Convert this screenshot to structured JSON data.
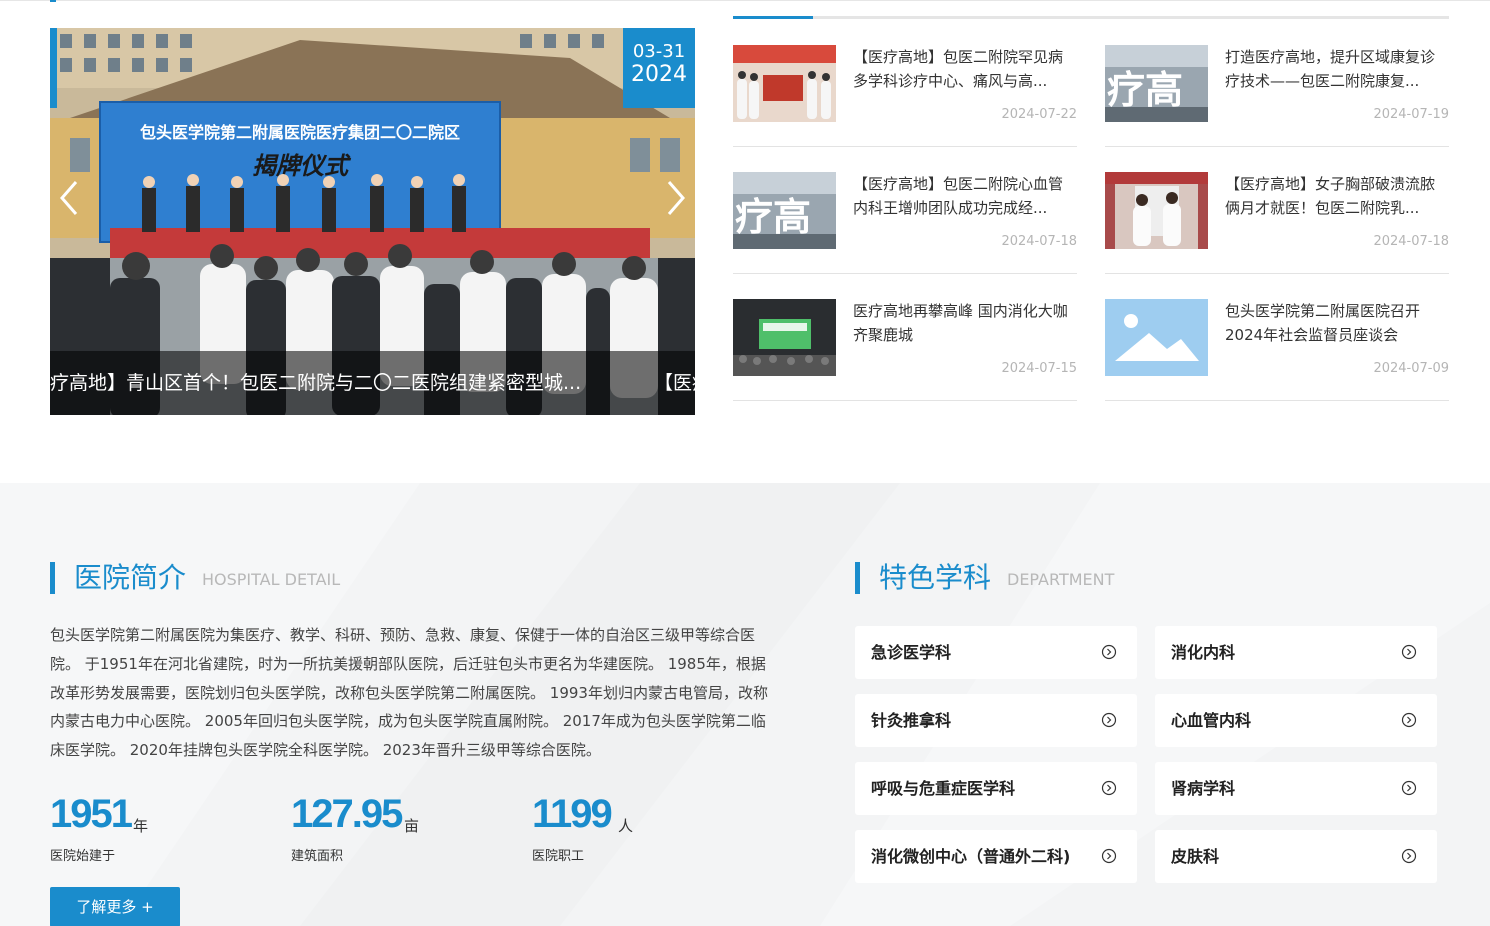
{
  "slider": {
    "date_md": "03-31",
    "date_year": "2024",
    "caption_current": "疗高地】青山区首个！包医二附院与二〇二医院组建紧密型城...",
    "caption_next": "【医疗",
    "banner_title": "包头医学院第二附属医院医疗集团二〇二院区",
    "banner_subtitle": "揭牌仪式",
    "prev_icon": "chevron-left-icon",
    "next_icon": "chevron-right-icon"
  },
  "news": [
    {
      "title": "【医疗高地】包医二附院罕见病多学科诊疗中心、痛风与高...",
      "date": "2024-07-22",
      "thumb": "photo"
    },
    {
      "title": "打造医疗高地，提升区域康复诊疗技术——包医二附院康复...",
      "date": "2024-07-19",
      "thumb": "photo"
    },
    {
      "title": "【医疗高地】包医二附院心血管内科王增帅团队成功完成经...",
      "date": "2024-07-18",
      "thumb": "photo"
    },
    {
      "title": "【医疗高地】女子胸部破溃流脓俩月才就医！包医二附院乳...",
      "date": "2024-07-18",
      "thumb": "photo"
    },
    {
      "title": "医疗高地再攀高峰 国内消化大咖齐聚鹿城",
      "date": "2024-07-15",
      "thumb": "photo"
    },
    {
      "title": "包头医学院第二附属医院召开2024年社会监督员座谈会",
      "date": "2024-07-09",
      "thumb": "image-placeholder-icon"
    }
  ],
  "intro": {
    "title": "医院简介",
    "subtitle": "HOSPITAL DETAIL",
    "text": "包头医学院第二附属医院为集医疗、教学、科研、预防、急救、康复、保健于一体的自治区三级甲等综合医院。 于1951年在河北省建院，时为一所抗美援朝部队医院，后迁驻包头市更名为华建医院。 1985年，根据改革形势发展需要，医院划归包头医学院，改称包头医学院第二附属医院。 1993年划归内蒙古电管局，改称内蒙古电力中心医院。 2005年回归包头医学院，成为包头医学院直属附院。 2017年成为包头医学院第二临床医学院。 2020年挂牌包头医学院全科医学院。 2023年晋升三级甲等综合医院。",
    "stats": [
      {
        "value": "1951",
        "unit": "年",
        "label": "医院始建于"
      },
      {
        "value": "127.95",
        "unit": "亩",
        "label": "建筑面积"
      },
      {
        "value": "1199",
        "unit": "人",
        "label": "医院职工"
      }
    ],
    "more_label": "了解更多 +"
  },
  "departments": {
    "title": "特色学科",
    "subtitle": "DEPARTMENT",
    "items": [
      {
        "name": "急诊医学科"
      },
      {
        "name": "消化内科"
      },
      {
        "name": "针灸推拿科"
      },
      {
        "name": "心血管内科"
      },
      {
        "name": "呼吸与危重症医学科"
      },
      {
        "name": "肾病学科"
      },
      {
        "name": "消化微创中心（普通外二科)"
      },
      {
        "name": "皮肤科"
      }
    ],
    "item_icon": "circle-chevron-right-icon"
  },
  "colors": {
    "accent": "#1a8ccc",
    "date_text": "#b5b5b5",
    "section_bg": "#f3f4f5"
  }
}
